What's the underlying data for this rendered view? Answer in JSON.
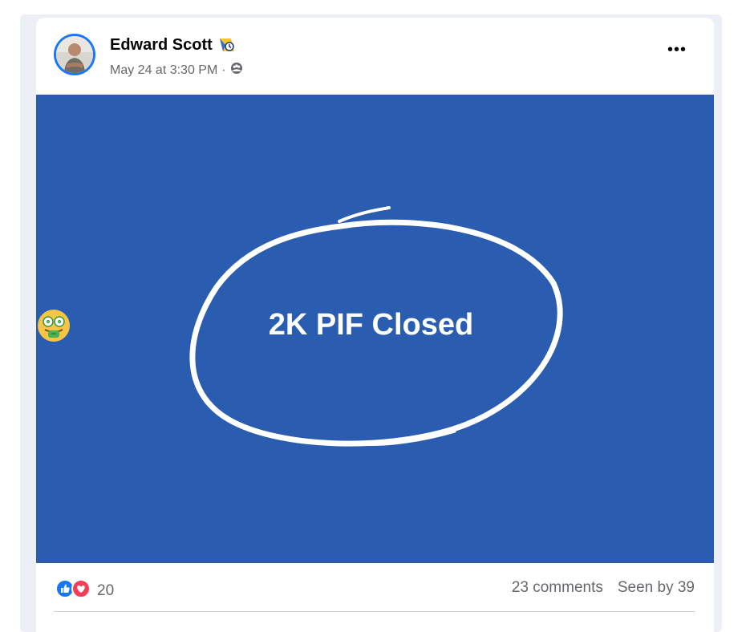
{
  "post": {
    "author": "Edward Scott",
    "timestamp": "May 24 at 3:30 PM",
    "separator": "·",
    "audience_icon": "group-icon",
    "more_label": "•••"
  },
  "banner": {
    "background_color": "#2a5caf",
    "text": "2K PIF Closed",
    "emoji": "money-mouth-face"
  },
  "engagement": {
    "reaction_count": "20",
    "comments": "23 comments",
    "seen": "Seen by 39"
  },
  "colors": {
    "like_blue": "#1877f2",
    "love_red": "#f33e58",
    "muted_text": "#65676b"
  }
}
